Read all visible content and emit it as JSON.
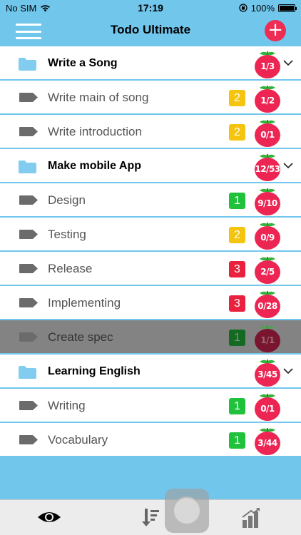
{
  "status": {
    "carrier": "No SIM",
    "time": "17:19",
    "battery": "100%",
    "battery_level": 1.0
  },
  "nav": {
    "title": "Todo Ultimate",
    "add_icon": "plus-icon",
    "menu_icon": "hamburger-icon"
  },
  "colors": {
    "accent": "#71c6ec",
    "tomato": "#ec2553",
    "priority_1": "#20c23b",
    "priority_2": "#f5c40f",
    "priority_3": "#e9213f",
    "tag": "#6b6b6b",
    "folder": "#82ccf0"
  },
  "rows": [
    {
      "type": "group",
      "title": "Write a Song",
      "count": "1/3"
    },
    {
      "type": "task",
      "title": "Write main of song",
      "priority": "2",
      "count": "1/2"
    },
    {
      "type": "task",
      "title": "Write introduction",
      "priority": "2",
      "count": "0/1"
    },
    {
      "type": "group",
      "title": "Make mobile App",
      "count": "12/53"
    },
    {
      "type": "task",
      "title": "Design",
      "priority": "1",
      "count": "9/10"
    },
    {
      "type": "task",
      "title": "Testing",
      "priority": "2",
      "count": "0/9"
    },
    {
      "type": "task",
      "title": "Release",
      "priority": "3",
      "count": "2/5"
    },
    {
      "type": "task",
      "title": "Implementing",
      "priority": "3",
      "count": "0/28"
    },
    {
      "type": "task",
      "title": "Create spec",
      "priority": "1",
      "count": "1/1",
      "selected": true
    },
    {
      "type": "group",
      "title": "Learning English",
      "count": "3/45"
    },
    {
      "type": "task",
      "title": "Writing",
      "priority": "1",
      "count": "0/1"
    },
    {
      "type": "task",
      "title": "Vocabulary",
      "priority": "1",
      "count": "3/44"
    }
  ],
  "tabbar": {
    "items": [
      "eye-icon",
      "sort-icon",
      "stats-icon"
    ]
  }
}
